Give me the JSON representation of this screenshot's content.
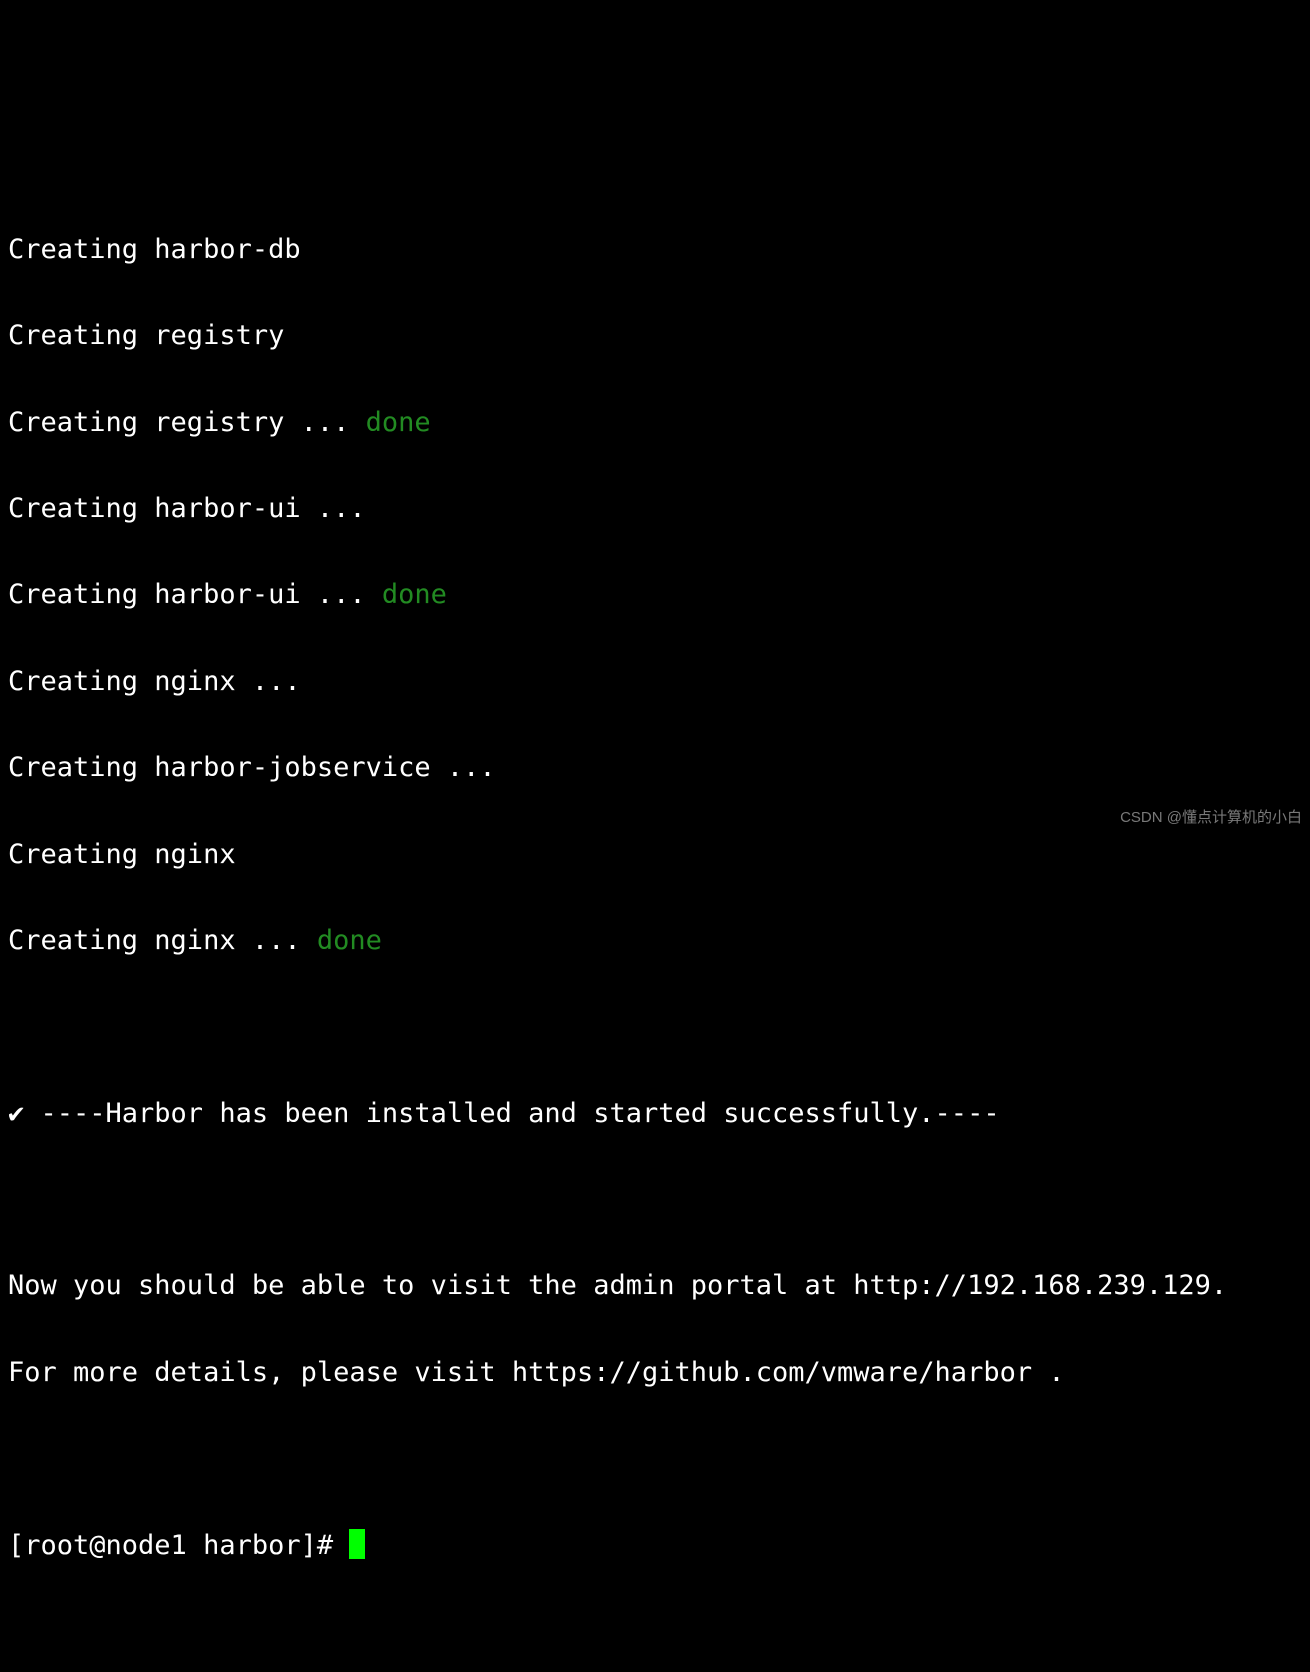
{
  "lines": {
    "l1": "Creating harbor-db",
    "l2": "Creating registry",
    "l3": "Creating registry ... ",
    "l3_done": "done",
    "l4": "Creating harbor-ui ...",
    "l5": "Creating harbor-ui ... ",
    "l5_done": "done",
    "l6": "Creating nginx ...",
    "l7": "Creating harbor-jobservice ...",
    "l8": "Creating nginx",
    "l9": "Creating nginx ... ",
    "l9_done": "done"
  },
  "success_line": "✔ ----Harbor has been installed and started successfully.----",
  "info_line1": "Now you should be able to visit the admin portal at http://192.168.239.129. ",
  "info_line2": "For more details, please visit https://github.com/vmware/harbor .",
  "prompt": "[root@node1 harbor]# ",
  "watermark": "CSDN @懂点计算机的小白"
}
